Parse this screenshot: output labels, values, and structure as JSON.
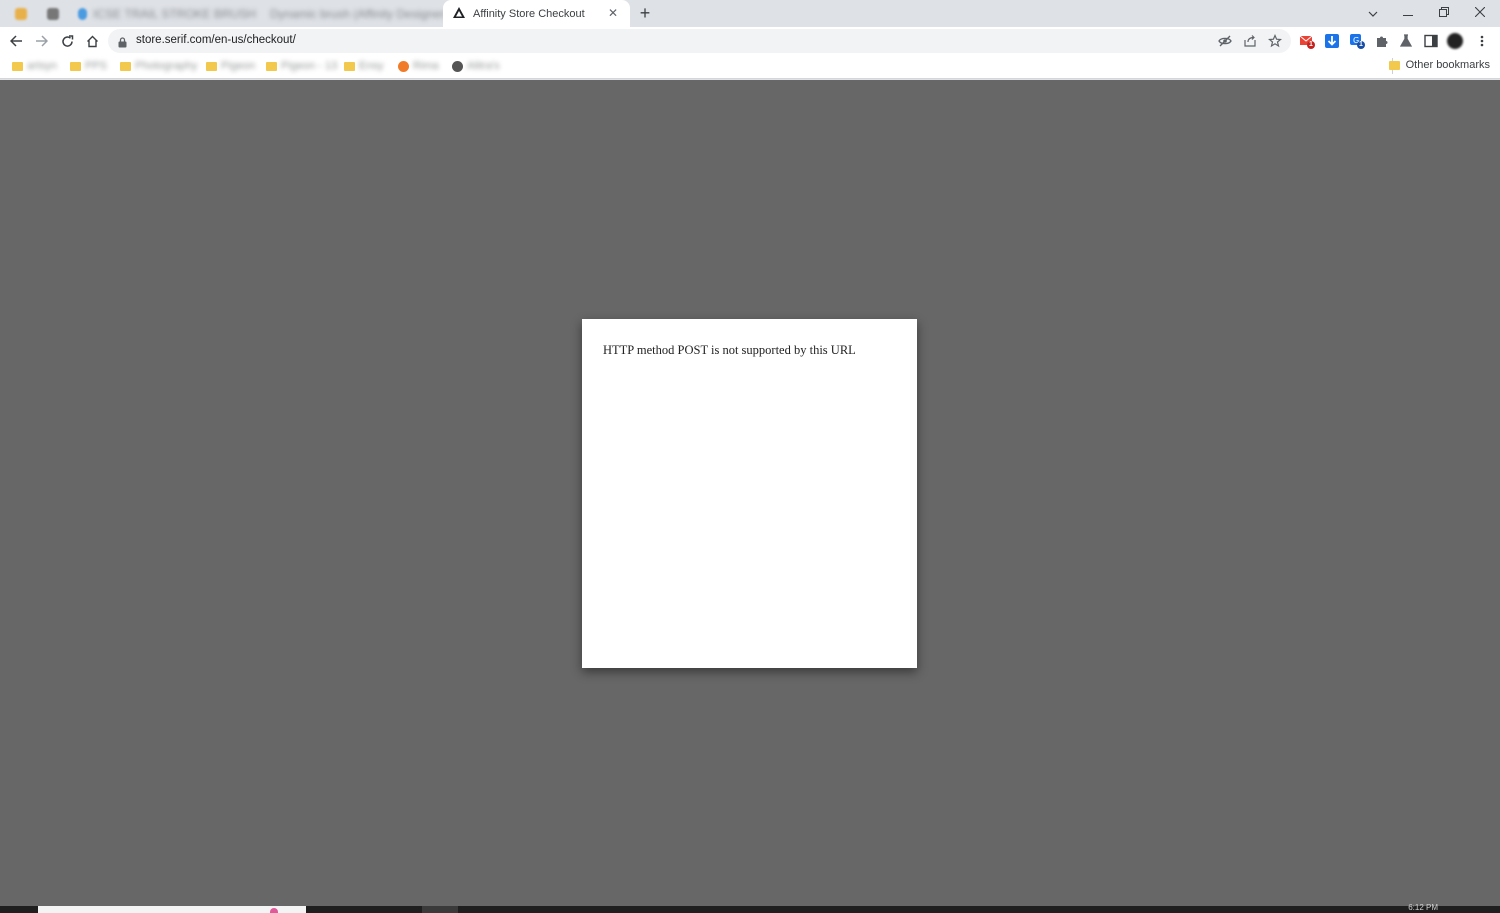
{
  "browser": {
    "tabs": {
      "inactive_1": "ICSE TRAIL STROKE BRUSH",
      "inactive_2": "Dynamic brush (Affinity Designer)",
      "active_title": "Affinity Store Checkout"
    },
    "address": {
      "url": "store.serif.com/en-us/checkout/"
    },
    "bookmarks": {
      "items": [
        "artsyn",
        "PPS",
        "Photography",
        "Pigeon",
        "Pigeon - 13",
        "Ensy",
        "Rima",
        "Alitra's"
      ],
      "other_label": "Other bookmarks"
    },
    "extensions": {
      "badge_1": "1",
      "badge_2": "1"
    }
  },
  "page": {
    "error_message": "HTTP method POST is not supported by this URL",
    "background_color": "#676767"
  },
  "taskbar": {
    "clock": "6:12 PM"
  }
}
